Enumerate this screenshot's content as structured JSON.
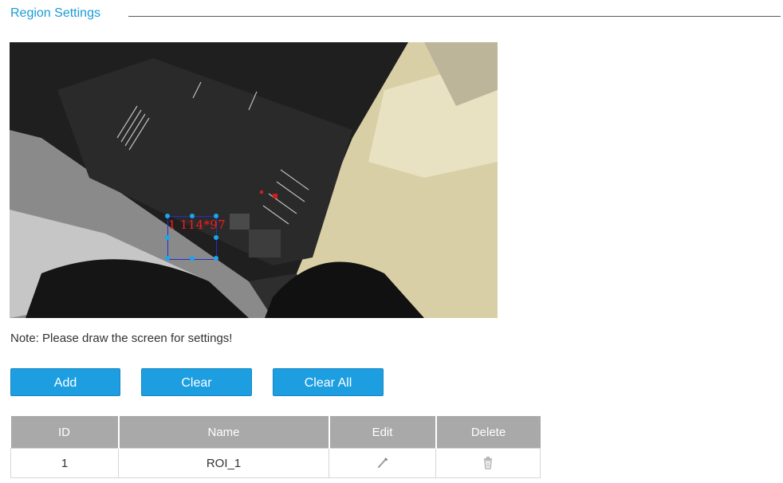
{
  "section": {
    "title": "Region Settings"
  },
  "roi_overlay": {
    "label": "1 114*97"
  },
  "note": "Note: Please draw the screen for settings!",
  "buttons": {
    "add": "Add",
    "clear": "Clear",
    "clear_all": "Clear All"
  },
  "table": {
    "headers": {
      "id": "ID",
      "name": "Name",
      "edit": "Edit",
      "delete": "Delete"
    },
    "rows": [
      {
        "id": "1",
        "name": "ROI_1",
        "edit_icon": "pencil-icon",
        "delete_icon": "trash-icon"
      }
    ]
  },
  "colors": {
    "accent": "#1c9ee0",
    "title": "#1a9bd7",
    "roi_border": "#1f2fd6",
    "roi_label": "#ff1a1a",
    "table_header": "#a9a9a9"
  }
}
